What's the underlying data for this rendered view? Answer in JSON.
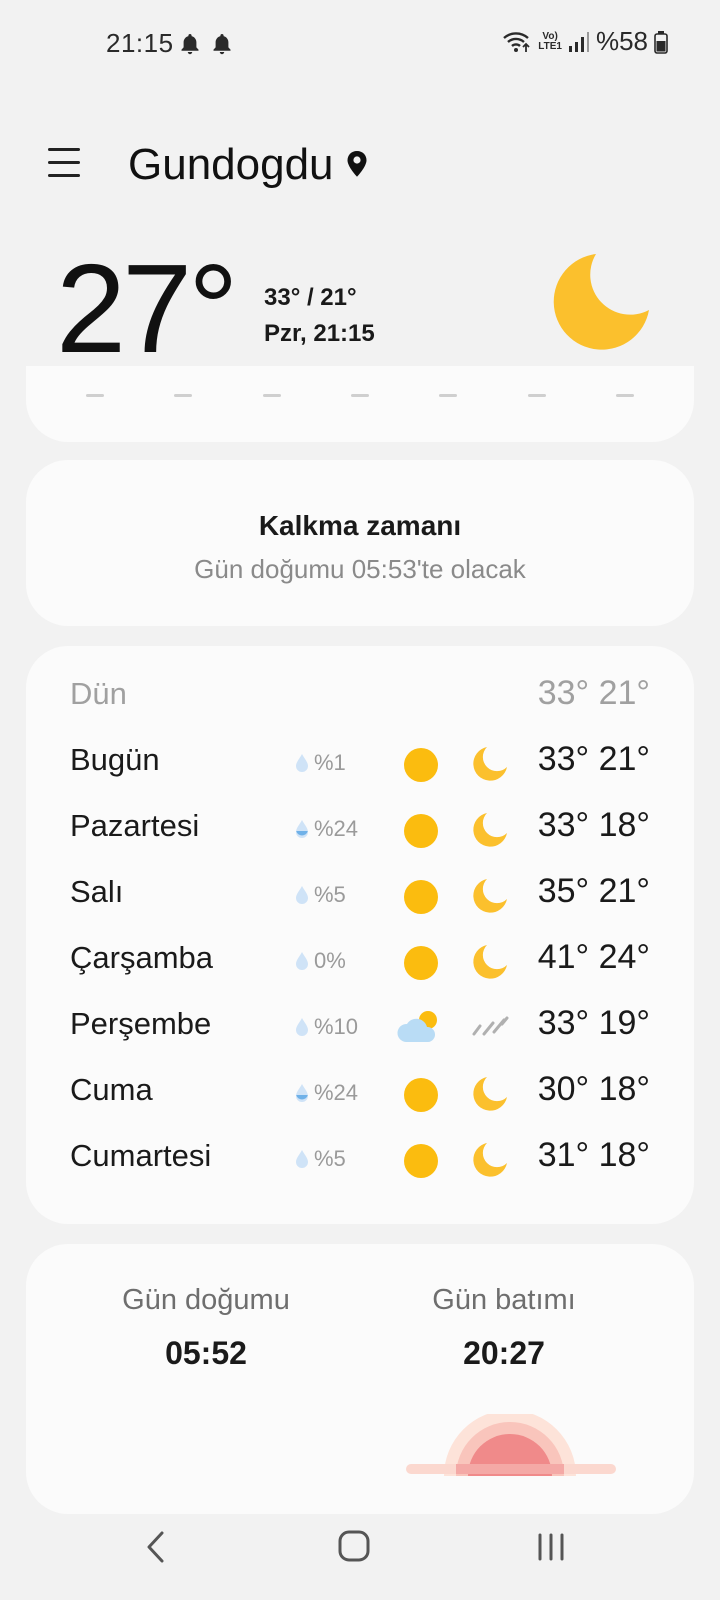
{
  "status_bar": {
    "time": "21:15",
    "network": "LTE1",
    "battery": "%58"
  },
  "header": {
    "location": "Gundogdu",
    "temperature": "27°",
    "high_low": "33° / 21°",
    "datetime": "Pzr, 21:15",
    "condition_icon": "moon-icon"
  },
  "sunrise_card": {
    "title": "Kalkma zamanı",
    "subtitle": "Gün doğumu 05:53'te olacak"
  },
  "forecast": {
    "yesterday": {
      "day": "Dün",
      "temps": "33° 21°"
    },
    "days": [
      {
        "day": "Bugün",
        "precip": "%1",
        "day_icon": "sun-icon",
        "night_icon": "moon-icon",
        "temps": "33° 21°"
      },
      {
        "day": "Pazartesi",
        "precip": "%24",
        "day_icon": "sun-icon",
        "night_icon": "moon-icon",
        "temps": "33° 18°"
      },
      {
        "day": "Salı",
        "precip": "%5",
        "day_icon": "sun-icon",
        "night_icon": "moon-icon",
        "temps": "35° 21°"
      },
      {
        "day": "Çarşamba",
        "precip": "0%",
        "day_icon": "sun-icon",
        "night_icon": "moon-icon",
        "temps": "41° 24°"
      },
      {
        "day": "Perşembe",
        "precip": "%10",
        "day_icon": "partly-cloudy-icon",
        "night_icon": "rain-icon",
        "temps": "33° 19°"
      },
      {
        "day": "Cuma",
        "precip": "%24",
        "day_icon": "sun-icon",
        "night_icon": "moon-icon",
        "temps": "30° 18°"
      },
      {
        "day": "Cumartesi",
        "precip": "%5",
        "day_icon": "sun-icon",
        "night_icon": "moon-icon",
        "temps": "31° 18°"
      }
    ]
  },
  "sun_times": {
    "sunrise_label": "Gün doğumu",
    "sunrise_time": "05:52",
    "sunset_label": "Gün batımı",
    "sunset_time": "20:27"
  },
  "colors": {
    "sun": "#fbbc0f",
    "moon": "#fbc02d",
    "card": "#fbfbfb",
    "background": "#f2f2f2"
  }
}
